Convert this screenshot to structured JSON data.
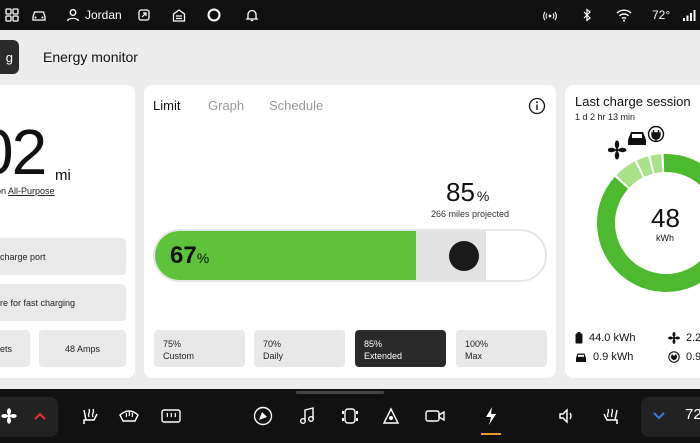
{
  "status_bar": {
    "user_name": "Jordan",
    "temperature": "72°"
  },
  "header": {
    "back_label": "g",
    "title": "Energy monitor"
  },
  "range": {
    "value": "02",
    "unit": "mi",
    "mode_prefix": "on",
    "mode_link": "All-Purpose"
  },
  "left_buttons": {
    "charge_port": "charge port",
    "fast_charging": "re for fast charging",
    "sets": "ets",
    "amps": "48 Amps"
  },
  "tabs": {
    "limit": "Limit",
    "graph": "Graph",
    "schedule": "Schedule"
  },
  "charge_limit": {
    "percent_value": "85",
    "percent_sign": "%",
    "projected": "266 miles projected",
    "current_value": "67",
    "current_sign": "%",
    "current_fraction": 0.67,
    "limit_fraction": 0.85,
    "colors": {
      "fill": "#5ec23a",
      "gap": "#e2e2e2",
      "knob": "#1b1b1b"
    }
  },
  "presets": [
    {
      "value": "75%",
      "label": "Custom"
    },
    {
      "value": "70%",
      "label": "Daily"
    },
    {
      "value": "85%",
      "label": "Extended"
    },
    {
      "value": "100%",
      "label": "Max"
    }
  ],
  "last_session": {
    "title": "Last charge session",
    "duration": "1 d 2 hr 13 min",
    "total": "48",
    "total_unit": "kWh",
    "stats": {
      "battery": "44.0 kWh",
      "climate": "2.2",
      "driving": "0.9 kWh",
      "other": "0.9"
    },
    "colors": {
      "primary": "#4cb92e",
      "secondary": "#a9e08a"
    }
  },
  "dock_temperature": "72"
}
